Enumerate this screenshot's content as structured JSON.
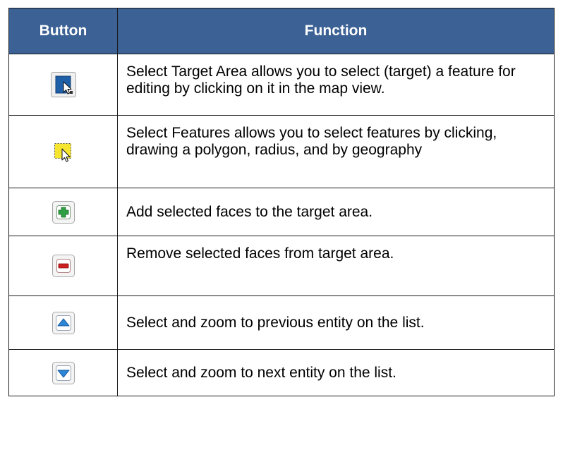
{
  "table": {
    "headers": {
      "button": "Button",
      "function": "Function"
    },
    "rows": [
      {
        "icon": "select-target-area-icon",
        "function": "Select Target Area allows you to select (target) a feature for editing by clicking on it in the map view."
      },
      {
        "icon": "select-features-icon",
        "function": "Select Features allows you to select features by clicking, drawing a polygon, radius, and by geography"
      },
      {
        "icon": "add-icon",
        "function": "Add selected faces to the target area."
      },
      {
        "icon": "remove-icon",
        "function": "Remove selected faces from target area."
      },
      {
        "icon": "previous-icon",
        "function": "Select and zoom to previous entity on the list."
      },
      {
        "icon": "next-icon",
        "function": "Select and zoom to next entity on the list."
      }
    ]
  },
  "colors": {
    "header_bg": "#3b6195",
    "header_text": "#ffffff",
    "border": "#1a1a1a"
  }
}
